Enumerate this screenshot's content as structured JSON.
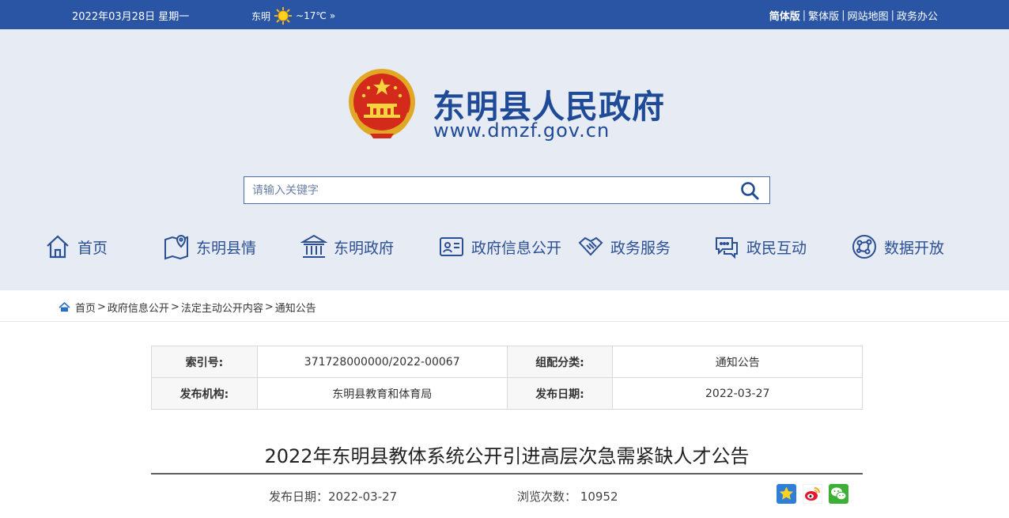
{
  "topbar": {
    "date": "2022年03月28日 星期一",
    "city": "东明",
    "temp": "~17℃",
    "more": "»",
    "links": [
      "简体版",
      "繁体版",
      "网站地图",
      "政务办公"
    ],
    "sep": "|"
  },
  "header": {
    "title": "东明县人民政府",
    "url": "www.dmzf.gov.cn",
    "search_placeholder": "请输入关键字"
  },
  "nav": [
    {
      "label": "首页",
      "icon": "home-icon"
    },
    {
      "label": "东明县情",
      "icon": "map-pin-icon"
    },
    {
      "label": "东明政府",
      "icon": "government-building-icon"
    },
    {
      "label": "政府信息公开",
      "icon": "id-card-icon"
    },
    {
      "label": "政务服务",
      "icon": "handshake-icon"
    },
    {
      "label": "政民互动",
      "icon": "chat-icon"
    },
    {
      "label": "数据开放",
      "icon": "network-icon"
    }
  ],
  "breadcrumb": [
    "首页",
    "政府信息公开",
    "法定主动公开内容",
    "通知公告"
  ],
  "breadcrumb_sep": ">",
  "info": {
    "index_label": "索引号:",
    "index_value": "371728000000/2022-00067",
    "category_label": "组配分类:",
    "category_value": "通知公告",
    "org_label": "发布机构:",
    "org_value": "东明县教育和体育局",
    "pubdate_label": "发布日期:",
    "pubdate_value": "2022-03-27"
  },
  "article": {
    "title": "2022年东明县教体系统公开引进高层次急需紧缺人才公告",
    "date_label": "发布日期：",
    "date_value": "2022-03-27",
    "views_label": "浏览次数：",
    "views_value": "10952"
  },
  "colors": {
    "topbar": "#2a55a5",
    "header_bg": "#e7ebf3",
    "brand": "#1f4a97"
  }
}
